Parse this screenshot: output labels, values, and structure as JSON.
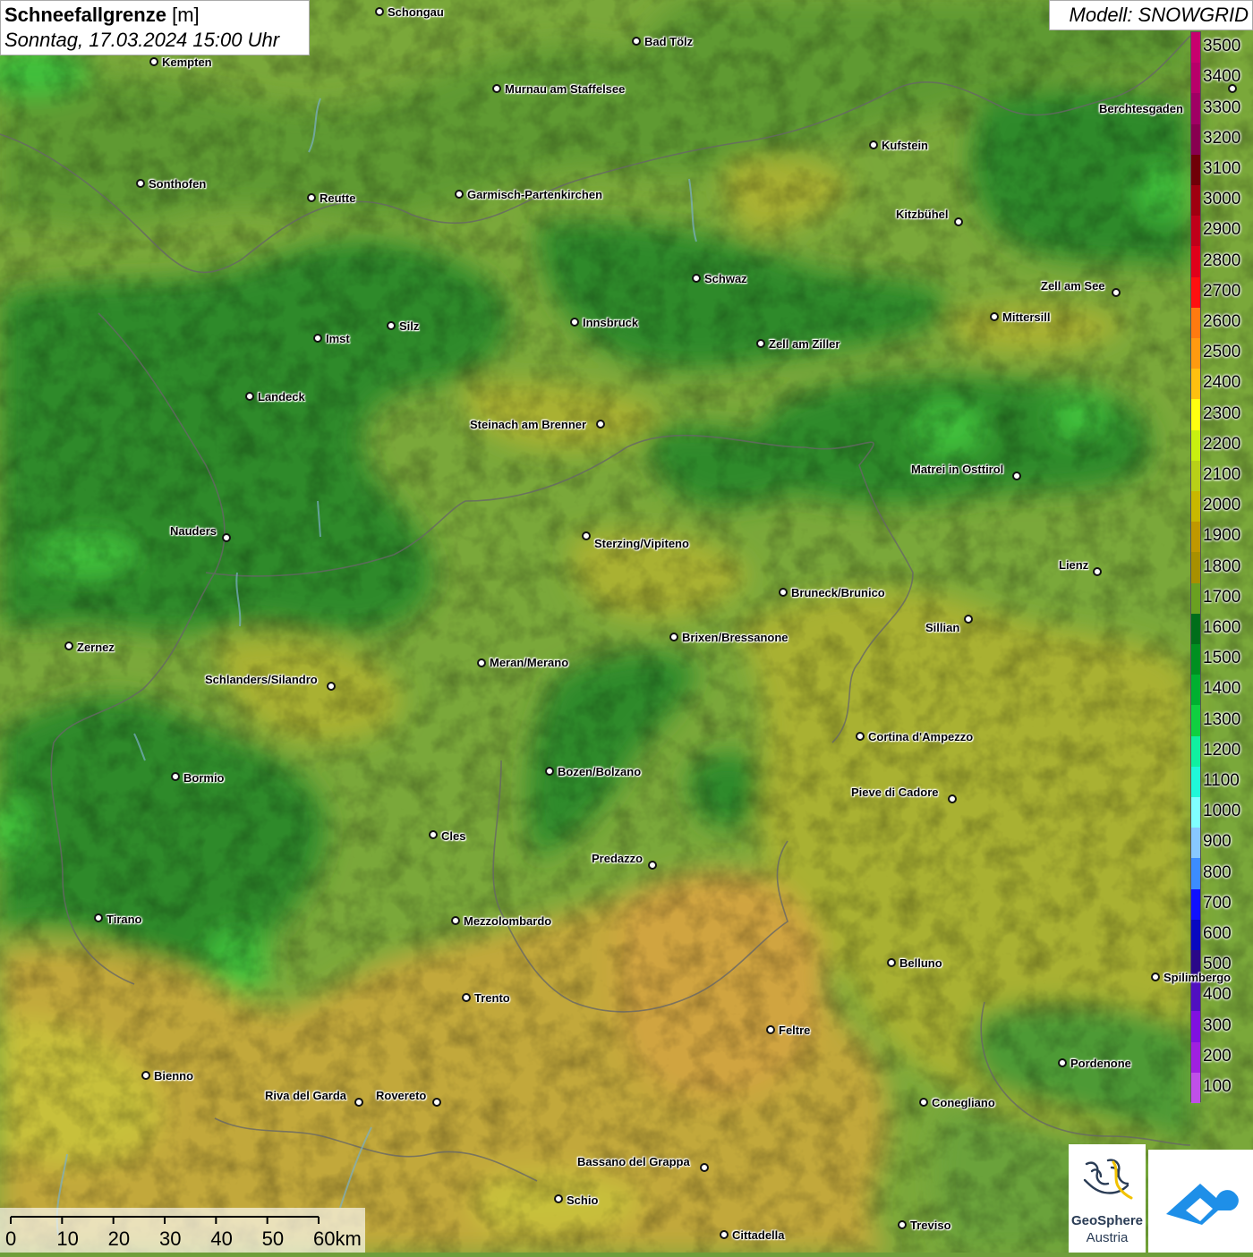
{
  "header": {
    "title_bold": "Schneefallgrenze",
    "title_unit": "[m]",
    "subtitle": "Sonntag, 17.03.2024 15:00 Uhr",
    "model": "Modell: SNOWGRID"
  },
  "legend": {
    "labels": [
      "3500",
      "3400",
      "3300",
      "3200",
      "3100",
      "3000",
      "2900",
      "2800",
      "2700",
      "2600",
      "2500",
      "2400",
      "2300",
      "2200",
      "2100",
      "2000",
      "1900",
      "1800",
      "1700",
      "1600",
      "1500",
      "1400",
      "1300",
      "1200",
      "1100",
      "1000",
      "900",
      "800",
      "700",
      "600",
      "500",
      "400",
      "300",
      "200",
      "100"
    ],
    "colors": [
      "#c8006e",
      "#b8006a",
      "#a00064",
      "#880050",
      "#700008",
      "#a00010",
      "#c0001a",
      "#e0001a",
      "#ff1010",
      "#ff7a10",
      "#ff9a10",
      "#ffc010",
      "#ffff10",
      "#c8f010",
      "#b8d018",
      "#c8b800",
      "#c09800",
      "#a89000",
      "#6aa020",
      "#006e1a",
      "#009020",
      "#00b030",
      "#10d040",
      "#10f0a0",
      "#20f8d8",
      "#80ffff",
      "#88c8ff",
      "#3c8cff",
      "#1010ff",
      "#0808c0",
      "#2a0888",
      "#5010c0",
      "#8010e0",
      "#a020e0",
      "#c050e8"
    ]
  },
  "cities": [
    {
      "name": "Schongau",
      "dot": [
        424,
        13
      ],
      "label": [
        433,
        7
      ]
    },
    {
      "name": "Bad Tölz",
      "dot": [
        711,
        46
      ],
      "label": [
        720,
        40
      ]
    },
    {
      "name": "Kempten",
      "dot": [
        172,
        69
      ],
      "label": [
        181,
        63
      ]
    },
    {
      "name": "Murnau am Staffelsee",
      "dot": [
        555,
        99
      ],
      "label": [
        564,
        93
      ]
    },
    {
      "name": "Berchtesgaden",
      "dot": [
        1377,
        99
      ],
      "label": [
        1228,
        115
      ]
    },
    {
      "name": "Kufstein",
      "dot": [
        976,
        162
      ],
      "label": [
        985,
        156
      ]
    },
    {
      "name": "Sonthofen",
      "dot": [
        157,
        205
      ],
      "label": [
        166,
        199
      ]
    },
    {
      "name": "Reutte",
      "dot": [
        348,
        221
      ],
      "label": [
        357,
        215
      ]
    },
    {
      "name": "Garmisch-Partenkirchen",
      "dot": [
        513,
        217
      ],
      "label": [
        522,
        211
      ]
    },
    {
      "name": "Kitzbühel",
      "dot": [
        1071,
        248
      ],
      "label": [
        1001,
        233
      ]
    },
    {
      "name": "Schwaz",
      "dot": [
        778,
        311
      ],
      "label": [
        787,
        305
      ]
    },
    {
      "name": "Zell am See",
      "dot": [
        1247,
        327
      ],
      "label": [
        1163,
        313
      ]
    },
    {
      "name": "Innsbruck",
      "dot": [
        642,
        360
      ],
      "label": [
        651,
        354
      ]
    },
    {
      "name": "Mittersill",
      "dot": [
        1111,
        354
      ],
      "label": [
        1120,
        348
      ]
    },
    {
      "name": "Silz",
      "dot": [
        437,
        364
      ],
      "label": [
        446,
        358
      ]
    },
    {
      "name": "Imst",
      "dot": [
        355,
        378
      ],
      "label": [
        364,
        372
      ]
    },
    {
      "name": "Zell am Ziller",
      "dot": [
        850,
        384
      ],
      "label": [
        859,
        378
      ]
    },
    {
      "name": "Landeck",
      "dot": [
        279,
        443
      ],
      "label": [
        288,
        437
      ]
    },
    {
      "name": "Steinach am Brenner",
      "dot": [
        671,
        474
      ],
      "label": [
        525,
        468
      ]
    },
    {
      "name": "Matrei in Osttirol",
      "dot": [
        1136,
        532
      ],
      "label": [
        1018,
        518
      ]
    },
    {
      "name": "Nauders",
      "dot": [
        253,
        601
      ],
      "label": [
        190,
        587
      ]
    },
    {
      "name": "Sterzing/Vipiteno",
      "dot": [
        655,
        599
      ],
      "label": [
        664,
        601
      ]
    },
    {
      "name": "Lienz",
      "dot": [
        1226,
        639
      ],
      "label": [
        1183,
        625
      ]
    },
    {
      "name": "Bruneck/Brunico",
      "dot": [
        875,
        662
      ],
      "label": [
        884,
        656
      ]
    },
    {
      "name": "Sillian",
      "dot": [
        1082,
        692
      ],
      "label": [
        1034,
        695
      ]
    },
    {
      "name": "Brixen/Bressanone",
      "dot": [
        753,
        712
      ],
      "label": [
        762,
        706
      ]
    },
    {
      "name": "Zernez",
      "dot": [
        77,
        722
      ],
      "label": [
        86,
        717
      ]
    },
    {
      "name": "Meran/Merano",
      "dot": [
        538,
        741
      ],
      "label": [
        547,
        734
      ]
    },
    {
      "name": "Schlanders/Silandro",
      "dot": [
        370,
        767
      ],
      "label": [
        229,
        753
      ]
    },
    {
      "name": "Cortina d'Ampezzo",
      "dot": [
        961,
        823
      ],
      "label": [
        970,
        817
      ]
    },
    {
      "name": "Bozen/Bolzano",
      "dot": [
        614,
        862
      ],
      "label": [
        623,
        856
      ]
    },
    {
      "name": "Bormio",
      "dot": [
        196,
        868
      ],
      "label": [
        205,
        863
      ]
    },
    {
      "name": "Pieve di Cadore",
      "dot": [
        1064,
        893
      ],
      "label": [
        951,
        879
      ]
    },
    {
      "name": "Cles",
      "dot": [
        484,
        933
      ],
      "label": [
        493,
        928
      ]
    },
    {
      "name": "Predazzo",
      "dot": [
        729,
        967
      ],
      "label": [
        661,
        953
      ]
    },
    {
      "name": "Tirano",
      "dot": [
        110,
        1026
      ],
      "label": [
        119,
        1021
      ]
    },
    {
      "name": "Mezzolombardo",
      "dot": [
        509,
        1029
      ],
      "label": [
        518,
        1023
      ]
    },
    {
      "name": "Belluno",
      "dot": [
        996,
        1076
      ],
      "label": [
        1005,
        1070
      ]
    },
    {
      "name": "Spilimbergo",
      "dot": [
        1291,
        1092
      ],
      "label": [
        1300,
        1086
      ]
    },
    {
      "name": "Trento",
      "dot": [
        521,
        1115
      ],
      "label": [
        530,
        1109
      ]
    },
    {
      "name": "Feltre",
      "dot": [
        861,
        1151
      ],
      "label": [
        870,
        1145
      ]
    },
    {
      "name": "Pordenone",
      "dot": [
        1187,
        1188
      ],
      "label": [
        1196,
        1182
      ]
    },
    {
      "name": "Bienno",
      "dot": [
        163,
        1202
      ],
      "label": [
        172,
        1196
      ]
    },
    {
      "name": "Riva del Garda",
      "dot": [
        401,
        1232
      ],
      "label": [
        296,
        1218
      ]
    },
    {
      "name": "Rovereto",
      "dot": [
        488,
        1232
      ],
      "label": [
        420,
        1218
      ]
    },
    {
      "name": "Conegliano",
      "dot": [
        1032,
        1232
      ],
      "label": [
        1041,
        1226
      ]
    },
    {
      "name": "Bassano del Grappa",
      "dot": [
        787,
        1305
      ],
      "label": [
        645,
        1292
      ]
    },
    {
      "name": "Schio",
      "dot": [
        624,
        1340
      ],
      "label": [
        633,
        1335
      ]
    },
    {
      "name": "Treviso",
      "dot": [
        1008,
        1369
      ],
      "label": [
        1017,
        1363
      ]
    },
    {
      "name": "Cittadella",
      "dot": [
        809,
        1380
      ],
      "label": [
        818,
        1374
      ]
    }
  ],
  "scale": {
    "labels": [
      "0",
      "10",
      "20",
      "30",
      "40",
      "50",
      "60km"
    ]
  },
  "logos": {
    "geosphere_line1": "GeoSphere",
    "geosphere_line2": "Austria"
  }
}
